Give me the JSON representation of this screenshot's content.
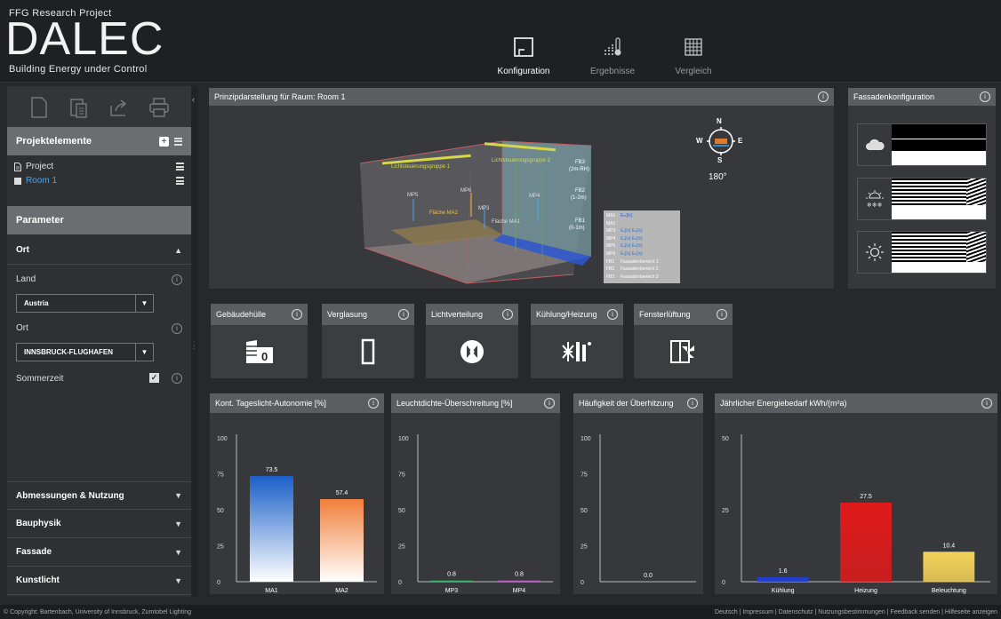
{
  "header": {
    "project": "FFG Research Project",
    "title": "DALEC",
    "tagline": "Building Energy under Control",
    "nav": [
      {
        "label": "Konfiguration",
        "icon": "room-icon"
      },
      {
        "label": "Ergebnisse",
        "icon": "thermometer-chart-icon"
      },
      {
        "label": "Vergleich",
        "icon": "table-icon"
      }
    ]
  },
  "sidebar": {
    "toolbar_icons": [
      "new-file-icon",
      "paste-icon",
      "share-icon",
      "print-icon"
    ],
    "projektelemente": {
      "title": "Projektelemente",
      "items": [
        {
          "label": "Project",
          "color": "#e0e0e0"
        },
        {
          "label": "Room 1",
          "color": "#4aa3e8"
        }
      ]
    },
    "parameter_title": "Parameter",
    "ort_section": {
      "title": "Ort",
      "land_label": "Land",
      "land_value": "Austria",
      "ort_label": "Ort",
      "ort_value": "INNSBRUCK-FLUGHAFEN",
      "sommerzeit_label": "Sommerzeit",
      "sommerzeit_checked": true
    },
    "accordions": [
      "Abmessungen & Nutzung",
      "Bauphysik",
      "Fassade",
      "Kunstlicht"
    ]
  },
  "room_panel": {
    "title": "Prinzipdarstellung für Raum: Room 1",
    "compass": {
      "n": "N",
      "s": "S",
      "e": "E",
      "w": "W",
      "angle": "180°"
    },
    "labels": {
      "group1": "Lichtsteuerungsgruppe 1",
      "group2": "Lichtsteuerungsgruppe 2",
      "fb3": "FB3",
      "fb3b": "(2m-RH)",
      "fb2": "FB2",
      "fb2b": "(1-2m)",
      "fb1": "FB1",
      "fb1b": "(0-1m)",
      "mp5": "MP5",
      "mp6": "MP6",
      "mp3": "MP3",
      "mp4": "MP4",
      "flaeche2": "Fläche MA2",
      "flaeche1": "Fläche MA1"
    },
    "legend": [
      {
        "key": "MA1",
        "val": "Eₘ[lx]"
      },
      {
        "key": "MA2",
        "val": ""
      },
      {
        "key": "MP3",
        "val": "Eᵥ[lx]  Eₕ[lx]"
      },
      {
        "key": "MP4",
        "val": "Eᵥ[lx]  Eₕ[lx]"
      },
      {
        "key": "MP5",
        "val": "Eᵥ[lx]  Eₕ[lx]"
      },
      {
        "key": "MP6",
        "val": "Eᵥ[lx]  Eₕ[lx]"
      },
      {
        "key": "FB1",
        "val": "Fassadenbereich 1"
      },
      {
        "key": "FB2",
        "val": "Fassadenbereich 2"
      },
      {
        "key": "FB3",
        "val": "Fassadenbereich 3"
      }
    ]
  },
  "fassade_panel": {
    "title": "Fassadenkonfiguration",
    "rows": [
      "cloud-icon",
      "sun-snow-icon",
      "sun-icon"
    ]
  },
  "tiles": [
    {
      "label": "Gebäudehülle",
      "icon": "building-envelope-icon",
      "badge": "0"
    },
    {
      "label": "Verglasung",
      "icon": "glazing-icon"
    },
    {
      "label": "Lichtverteilung",
      "icon": "light-distribution-icon"
    },
    {
      "label": "Kühlung/Heizung",
      "icon": "cooling-heating-icon"
    },
    {
      "label": "Fensterlüftung",
      "icon": "window-ventilation-icon"
    }
  ],
  "chart_data": [
    {
      "type": "bar",
      "title": "Kont. Tageslicht-Autonomie [%]",
      "categories": [
        "MA1",
        "MA2"
      ],
      "values": [
        73.5,
        57.4
      ],
      "value_labels": [
        "73.5",
        "57.4"
      ],
      "ylim": [
        0,
        100
      ],
      "yticks": [
        "100",
        "75",
        "50",
        "25",
        "0"
      ],
      "colors": [
        "#1a5fc8",
        "#f07f3a"
      ]
    },
    {
      "type": "bar",
      "title": "Leuchtdichte-Überschreitung [%]",
      "categories": [
        "MP3",
        "MP4"
      ],
      "values": [
        0.8,
        0.8
      ],
      "value_labels": [
        "0.8",
        "0.8"
      ],
      "ylim": [
        0,
        100
      ],
      "yticks": [
        "100",
        "75",
        "50",
        "25",
        "0"
      ],
      "colors": [
        "#3cb371",
        "#c060c0"
      ]
    },
    {
      "type": "bar",
      "title": "Häufigkeit der Überhitzung",
      "categories": [],
      "values": [
        0.0
      ],
      "value_labels": [
        "0.0"
      ],
      "ylim": [
        0,
        100
      ],
      "yticks": [
        "100",
        "75",
        "50",
        "25",
        "0"
      ],
      "colors": [
        "#888888"
      ]
    },
    {
      "type": "bar",
      "title": "Jährlicher Energiebedarf kWh/(m²a)",
      "categories": [
        "Kühlung",
        "Heizung",
        "Beleuchtung"
      ],
      "values": [
        1.6,
        27.5,
        10.4
      ],
      "value_labels": [
        "1.6",
        "27.5",
        "10.4"
      ],
      "ylim": [
        0,
        50
      ],
      "yticks": [
        "50",
        "25",
        "0"
      ],
      "colors": [
        "#1f3fd6",
        "#e01a1a",
        "#f4d25a"
      ]
    }
  ],
  "footer": {
    "copyright": "© Copyright: Bartenbach, University of Innsbruck, Zumtobel Lighting",
    "links": "Deutsch | Impressum | Datenschutz | Nutzungsbestimmungen | Feedback senden | Hilfeseite anzeigen"
  }
}
